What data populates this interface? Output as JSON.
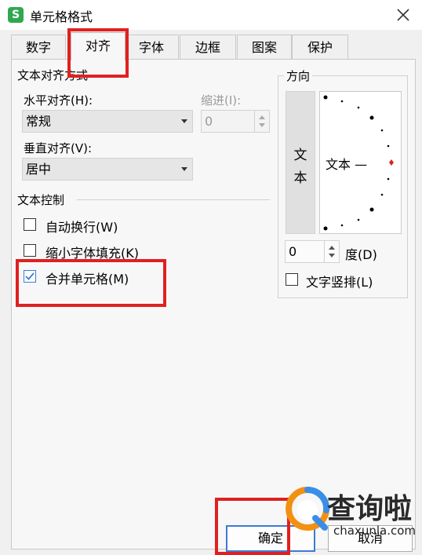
{
  "window": {
    "title": "单元格格式",
    "app_icon_letter": "S"
  },
  "tabs": [
    {
      "label": "数字",
      "active": false
    },
    {
      "label": "对齐",
      "active": true
    },
    {
      "label": "字体",
      "active": false
    },
    {
      "label": "边框",
      "active": false
    },
    {
      "label": "图案",
      "active": false
    },
    {
      "label": "保护",
      "active": false
    }
  ],
  "alignment": {
    "group_label": "文本对齐方式",
    "horizontal_label": "水平对齐(H):",
    "horizontal_value": "常规",
    "indent_label": "缩进(I):",
    "indent_value": "0",
    "vertical_label": "垂直对齐(V):",
    "vertical_value": "居中"
  },
  "text_control": {
    "group_label": "文本控制",
    "options": [
      {
        "label": "自动换行(W)",
        "checked": false
      },
      {
        "label": "缩小字体填充(K)",
        "checked": false
      },
      {
        "label": "合并单元格(M)",
        "checked": true
      }
    ]
  },
  "orientation": {
    "group_label": "方向",
    "vertical_text": [
      "文",
      "本"
    ],
    "dial_text": "文本 —",
    "degree_value": "0",
    "degree_label": "度(D)",
    "vertical_layout_label": "文字竖排(L)",
    "vertical_layout_checked": false
  },
  "buttons": {
    "ok": "确定",
    "cancel": "取消"
  },
  "watermark": {
    "text": "查询啦",
    "url": "chaxunla.com"
  },
  "colors": {
    "highlight": "#e02020",
    "accent": "#3c7ad6",
    "app_icon": "#2fa84f",
    "dial_marker": "#e02020"
  }
}
